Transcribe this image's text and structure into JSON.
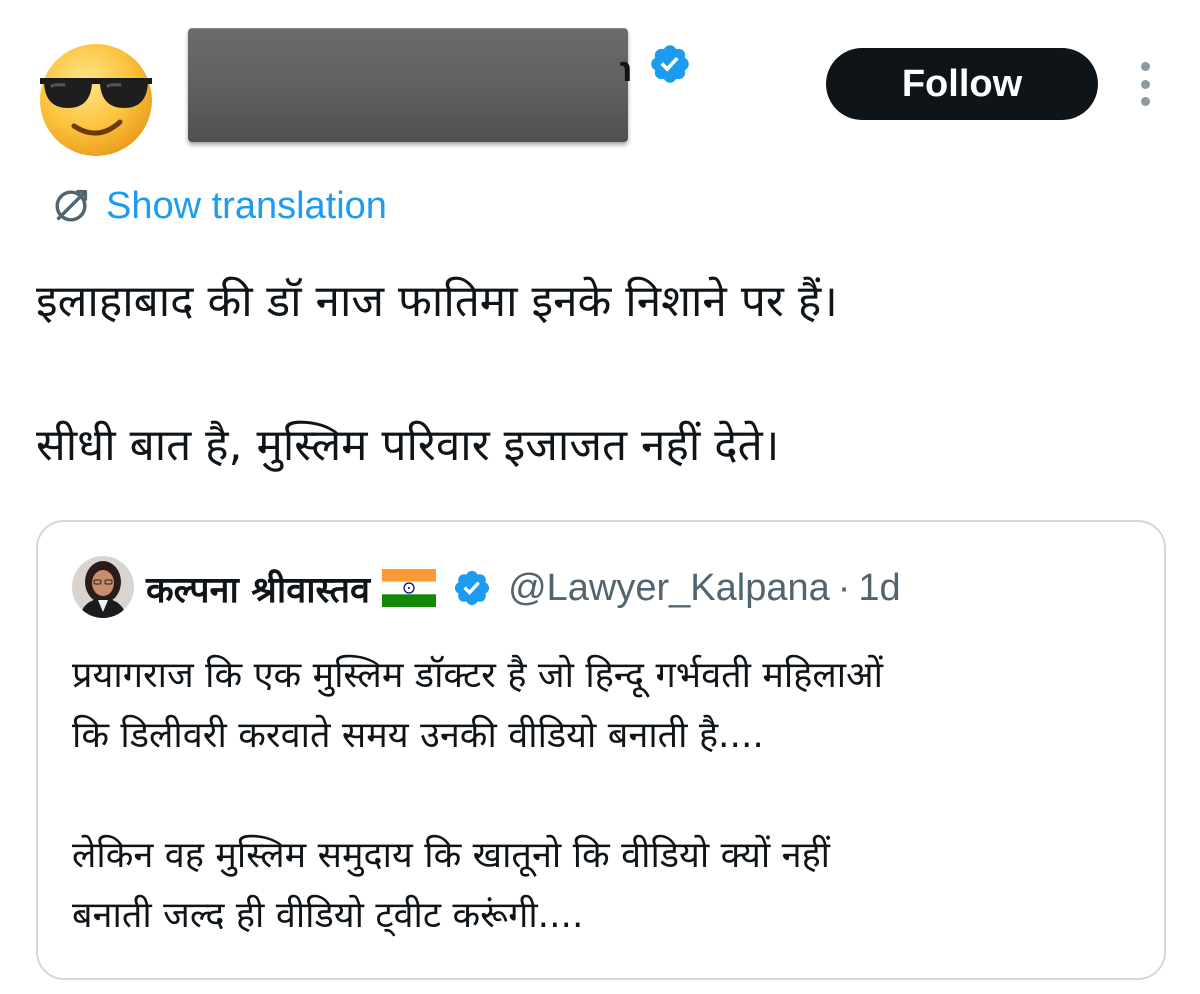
{
  "colors": {
    "accent": "#1d9bf0",
    "text_primary": "#0f1419",
    "text_secondary": "#536471",
    "follow_button_bg": "#0f1419",
    "follow_button_text": "#ffffff",
    "card_border": "#cfd9de",
    "redaction": "#5f5f5f"
  },
  "author": {
    "avatar_icon": "sunglasses-emoji-avatar",
    "name_redacted": true,
    "name_visible_tail": "n",
    "verified_icon": "verified-badge-icon"
  },
  "header": {
    "follow_label": "Follow",
    "more_icon": "more-vertical-icon"
  },
  "translation": {
    "icon": "translate-globe-icon",
    "label": "Show translation"
  },
  "tweet": {
    "line1": "इलाहाबाद की डॉ नाज फातिमा इनके निशाने पर हैं।",
    "line2": "सीधी बात है, मुस्लिम परिवार इजाजत नहीं देते।"
  },
  "quote": {
    "avatar_icon": "user-photo-avatar",
    "name": "कल्पना श्रीवास्तव",
    "flag_icon": "india-flag-icon",
    "verified_icon": "verified-badge-icon",
    "handle": "@Lawyer_Kalpana",
    "separator": "·",
    "time": "1d",
    "line1": "प्रयागराज कि एक मुस्लिम डॉक्टर है जो हिन्दू गर्भवती महिलाओं",
    "line2": "कि डिलीवरी करवाते समय उनकी वीडियो बनाती है....",
    "line3": "लेकिन वह मुस्लिम समुदाय कि खातूनो कि वीडियो क्यों नहीं",
    "line4": "बनाती जल्द ही वीडियो ट्वीट करूंगी...."
  }
}
